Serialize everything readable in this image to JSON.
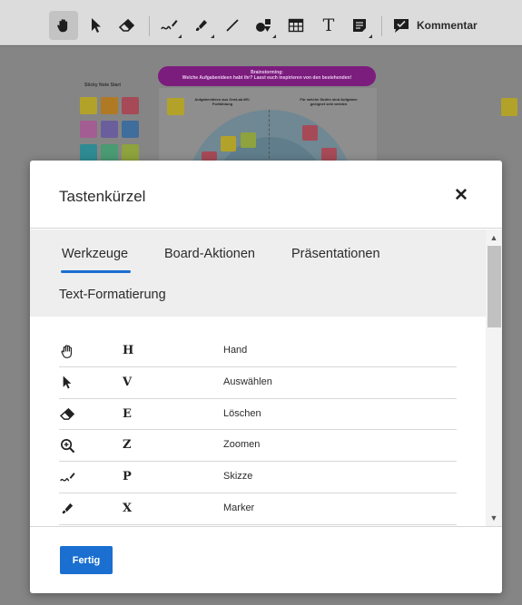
{
  "toolbar": {
    "tools": [
      {
        "id": "hand",
        "icon": "hand-icon",
        "glyph": "✋"
      },
      {
        "id": "select",
        "icon": "pointer-icon",
        "glyph": "↖"
      },
      {
        "id": "eraser",
        "icon": "eraser-icon",
        "glyph": "⌫"
      },
      {
        "id": "pen",
        "icon": "pen-icon",
        "glyph": "✎"
      },
      {
        "id": "marker",
        "icon": "marker-icon",
        "glyph": "✏"
      },
      {
        "id": "line",
        "icon": "line-icon",
        "glyph": "╱"
      },
      {
        "id": "shapes",
        "icon": "shapes-icon",
        "glyph": "◆"
      },
      {
        "id": "table",
        "icon": "table-icon",
        "glyph": "▦"
      },
      {
        "id": "text",
        "icon": "text-icon",
        "glyph": "T"
      },
      {
        "id": "sticky",
        "icon": "sticky-note-icon",
        "glyph": "▤"
      }
    ],
    "comment_label": "Kommentar"
  },
  "board": {
    "sticky_title": "Sticky Note Start",
    "banner_line1": "Brainstorming:",
    "banner_line2": "Welche Aufgabenideen habt ihr? Lasst euch inspirieren von den bestehenden!",
    "left_sub": "Aufgabenideen aus OneLab-MV-Fortbildung",
    "right_sub": "Für welche Stufen sind Aufgaben geeignet sein werden"
  },
  "modal": {
    "title": "Tastenkürzel",
    "close_icon": "close-icon",
    "tabs": [
      {
        "label": "Werkzeuge",
        "active": true
      },
      {
        "label": "Board-Aktionen",
        "active": false
      },
      {
        "label": "Präsentationen",
        "active": false
      },
      {
        "label": "Text-Formatierung",
        "active": false
      }
    ],
    "shortcuts": [
      {
        "icon": "hand-icon",
        "key": "H",
        "action": "Hand"
      },
      {
        "icon": "pointer-icon",
        "key": "V",
        "action": "Auswählen"
      },
      {
        "icon": "eraser-icon",
        "key": "E",
        "action": "Löschen"
      },
      {
        "icon": "zoom-icon",
        "key": "Z",
        "action": "Zoomen"
      },
      {
        "icon": "pen-icon",
        "key": "P",
        "action": "Skizze"
      },
      {
        "icon": "marker-icon",
        "key": "X",
        "action": "Marker"
      }
    ],
    "done_label": "Fertig"
  },
  "colors": {
    "accent": "#1a6fd1",
    "tab_bg": "#eeeeee",
    "banner": "#7b1d7d"
  }
}
